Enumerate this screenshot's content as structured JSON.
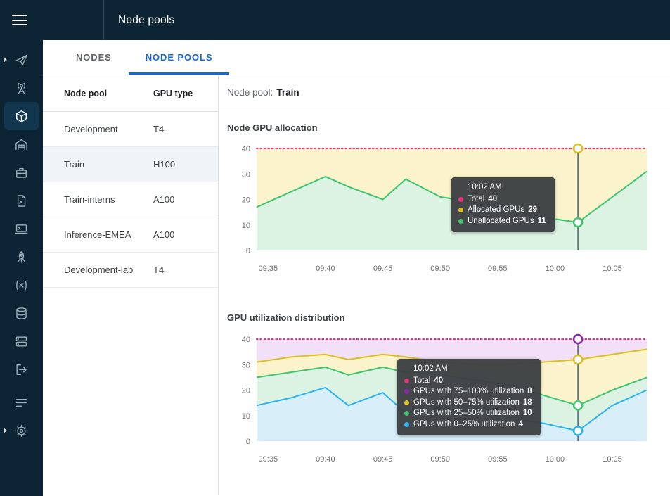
{
  "header": {
    "title": "Node pools"
  },
  "sidebar": {
    "items": [
      {
        "icon": "send",
        "expandable": true
      },
      {
        "icon": "satellite"
      },
      {
        "icon": "cube",
        "active": true
      },
      {
        "icon": "warehouse"
      },
      {
        "icon": "briefcase"
      },
      {
        "icon": "script"
      },
      {
        "icon": "terminal"
      },
      {
        "icon": "rocket"
      },
      {
        "icon": "function"
      },
      {
        "icon": "database"
      },
      {
        "icon": "servers"
      },
      {
        "icon": "deploy"
      },
      {
        "icon": "queue"
      },
      {
        "icon": "settings",
        "expandable": true
      }
    ]
  },
  "tabs": [
    {
      "label": "NODES",
      "active": false
    },
    {
      "label": "NODE POOLS",
      "active": true
    }
  ],
  "table": {
    "columns": [
      "Node pool",
      "GPU type"
    ],
    "rows": [
      {
        "name": "Development",
        "gpu": "T4",
        "selected": false
      },
      {
        "name": "Train",
        "gpu": "H100",
        "selected": true
      },
      {
        "name": "Train-interns",
        "gpu": "A100",
        "selected": false
      },
      {
        "name": "Inference-EMEA",
        "gpu": "A100",
        "selected": false
      },
      {
        "name": "Development-lab",
        "gpu": "T4",
        "selected": false
      }
    ]
  },
  "detail": {
    "label": "Node pool:",
    "value": "Train"
  },
  "theme": {
    "header_bg": "#0c2434",
    "accent_blue": "#1967d2",
    "total_magenta": "#e5347e",
    "allocated_yellow": "#dcc023",
    "unallocated_green": "#41c46f",
    "util_purple": "#8e24aa",
    "util_blue": "#2bb3ef"
  },
  "chart_data": [
    {
      "type": "area",
      "stacked": true,
      "title": "Node GPU allocation",
      "x_domain": [
        "09:34",
        "10:08"
      ],
      "x": [
        "09:34",
        "09:37",
        "09:40",
        "09:42",
        "09:45",
        "09:47",
        "09:50",
        "09:53",
        "09:56",
        "09:59",
        "10:02",
        "10:05",
        "10:08"
      ],
      "x_ticks": [
        "09:35",
        "09:40",
        "09:45",
        "09:50",
        "09:55",
        "10:00",
        "10:05"
      ],
      "ylim": [
        0,
        40
      ],
      "y_ticks": [
        0,
        10,
        20,
        30,
        40
      ],
      "legend": "none",
      "grid": false,
      "marker_time": "10:02",
      "series": [
        {
          "name": "Unallocated GPUs",
          "color": "#41c46f",
          "fill": "#dcf3e4",
          "values": [
            17,
            23,
            29,
            25,
            20,
            28,
            21,
            19,
            16,
            13,
            11,
            21,
            31
          ]
        },
        {
          "name": "Allocated GPUs",
          "color": "#dcc023",
          "fill": "#faf3cb",
          "hide_line": true,
          "values": [
            23,
            17,
            11,
            15,
            20,
            12,
            19,
            21,
            24,
            27,
            29,
            19,
            9
          ]
        },
        {
          "name": "Total",
          "total": true,
          "style": "dotted",
          "color": "#e5347e",
          "value": 40
        }
      ],
      "tooltip": {
        "time": "10:02 AM",
        "rows": [
          {
            "label": "Total",
            "value": "40",
            "color": "#e5347e"
          },
          {
            "label": "Allocated GPUs",
            "value": "29",
            "color": "#dcc023"
          },
          {
            "label": "Unallocated GPUs",
            "value": "11",
            "color": "#41c46f"
          }
        ]
      }
    },
    {
      "type": "area",
      "stacked": true,
      "title": "GPU utilization distribution",
      "x_domain": [
        "09:34",
        "10:08"
      ],
      "x": [
        "09:34",
        "09:37",
        "09:40",
        "09:42",
        "09:45",
        "09:47",
        "09:50",
        "09:53",
        "09:56",
        "09:59",
        "10:02",
        "10:05",
        "10:08"
      ],
      "x_ticks": [
        "09:35",
        "09:40",
        "09:45",
        "09:50",
        "09:55",
        "10:00",
        "10:05"
      ],
      "ylim": [
        0,
        40
      ],
      "y_ticks": [
        0,
        10,
        20,
        30,
        40
      ],
      "legend": "none",
      "grid": false,
      "marker_time": "10:02",
      "series": [
        {
          "name": "GPUs with 0–25% utilization",
          "color": "#2bb3ef",
          "fill": "#d8effa",
          "values": [
            14,
            17,
            21,
            14,
            19,
            11,
            13,
            11,
            9,
            7,
            4,
            14,
            20
          ]
        },
        {
          "name": "GPUs with 25–50% utilization",
          "color": "#41c46f",
          "fill": "#dcf3e4",
          "values": [
            11,
            10,
            8,
            12,
            10,
            16,
            13,
            13,
            13,
            11,
            10,
            6,
            5
          ]
        },
        {
          "name": "GPUs with 50–75% utilization",
          "color": "#dcc023",
          "fill": "#faf3cb",
          "values": [
            6,
            6,
            5,
            6,
            5,
            6,
            5,
            6,
            8,
            13,
            18,
            14,
            11
          ]
        },
        {
          "name": "GPUs with 75–100% utilization",
          "color": "#8e24aa",
          "fill": "#f1e0f7",
          "hide_line": true,
          "values": [
            9,
            7,
            6,
            8,
            6,
            7,
            9,
            10,
            10,
            9,
            8,
            6,
            4
          ]
        },
        {
          "name": "Total",
          "total": true,
          "style": "dotted",
          "color": "#e5347e",
          "value": 40
        }
      ],
      "tooltip": {
        "time": "10:02 AM",
        "rows": [
          {
            "label": "Total",
            "value": "40",
            "color": "#e5347e"
          },
          {
            "label": "GPUs with 75–100% utilization",
            "value": "8",
            "color": "#8e24aa"
          },
          {
            "label": "GPUs with 50–75% utilization",
            "value": "18",
            "color": "#dcc023"
          },
          {
            "label": "GPUs with 25–50% utilization",
            "value": "10",
            "color": "#41c46f"
          },
          {
            "label": "GPUs with 0–25% utilization",
            "value": "4",
            "color": "#2bb3ef"
          }
        ]
      }
    }
  ]
}
